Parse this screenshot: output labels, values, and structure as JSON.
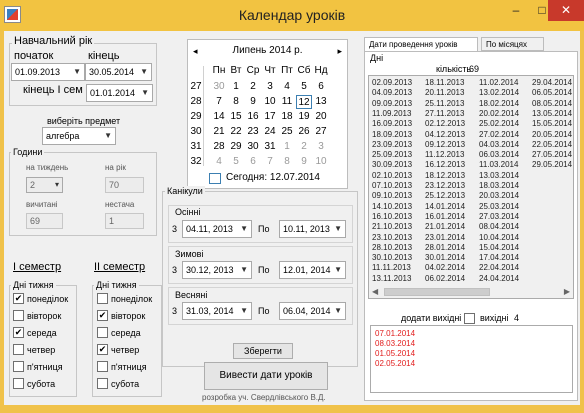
{
  "window": {
    "title": "Календар уроків",
    "min": "–",
    "max": "□",
    "close": "✕"
  },
  "year": {
    "caption": "Навчальний рік",
    "start_label": "початок",
    "start_value": "01.09.2013",
    "end_label": "кінець",
    "end_value": "30.05.2014",
    "sem_end_label": "кінець І сем",
    "sem_end_value": "01.01.2014"
  },
  "subject": {
    "label": "виберіть предмет",
    "value": "алгебра"
  },
  "hours": {
    "caption": "Години",
    "per_week_label": "на тиждень",
    "per_week_value": "2",
    "per_year_label": "на рік",
    "per_year_value": "70",
    "taught_label": "вичитані",
    "taught_value": "69",
    "shortage_label": "нестача",
    "shortage_value": "1"
  },
  "sem1": {
    "title": "І семестр",
    "days_label": "Дні тижня",
    "days": [
      {
        "label": "понеділок",
        "checked": "✔"
      },
      {
        "label": "вівторок",
        "checked": ""
      },
      {
        "label": "середа",
        "checked": "✔"
      },
      {
        "label": "четвер",
        "checked": ""
      },
      {
        "label": "п'ятниця",
        "checked": ""
      },
      {
        "label": "субота",
        "checked": ""
      }
    ]
  },
  "sem2": {
    "title": "ІІ семестр",
    "days_label": "Дні тижня",
    "days": [
      {
        "label": "понеділок",
        "checked": ""
      },
      {
        "label": "вівторок",
        "checked": "✔"
      },
      {
        "label": "середа",
        "checked": ""
      },
      {
        "label": "четвер",
        "checked": "✔"
      },
      {
        "label": "п'ятниця",
        "checked": ""
      },
      {
        "label": "субота",
        "checked": ""
      }
    ]
  },
  "calendar": {
    "prev": "◂",
    "next": "▸",
    "month": "Липень 2014 р.",
    "dow": [
      "Пн",
      "Вт",
      "Ср",
      "Чт",
      "Пт",
      "Сб",
      "Нд"
    ],
    "weeks": [
      {
        "wk": "27",
        "days": [
          "30",
          "1",
          "2",
          "3",
          "4",
          "5",
          "6"
        ]
      },
      {
        "wk": "28",
        "days": [
          "7",
          "8",
          "9",
          "10",
          "11",
          "12",
          "13"
        ]
      },
      {
        "wk": "29",
        "days": [
          "14",
          "15",
          "16",
          "17",
          "18",
          "19",
          "20"
        ]
      },
      {
        "wk": "30",
        "days": [
          "21",
          "22",
          "23",
          "24",
          "25",
          "26",
          "27"
        ]
      },
      {
        "wk": "31",
        "days": [
          "28",
          "29",
          "30",
          "31",
          "1",
          "2",
          "3"
        ]
      },
      {
        "wk": "32",
        "days": [
          "4",
          "5",
          "6",
          "7",
          "8",
          "9",
          "10"
        ]
      }
    ],
    "today_label": "Сегодня: 12.07.2014"
  },
  "vacations": {
    "caption": "Канікули",
    "autumn": {
      "title": "Осінні",
      "num": "3",
      "from": "04.11, 2013",
      "to_label": "По",
      "to": "10.11, 2013"
    },
    "winter": {
      "title": "Зимові",
      "num": "3",
      "from": "30.12, 2013",
      "to_label": "По",
      "to": "12.01, 2014"
    },
    "spring": {
      "title": "Весняні",
      "num": "3",
      "from": "31.03, 2014",
      "to_label": "По",
      "to": "06.04, 2014"
    }
  },
  "buttons": {
    "save": "Зберегти",
    "output": "Вивести дати уроків"
  },
  "credit": "розробка уч. Свердлівського В.Д.",
  "tabs": {
    "dates": "Дати проведення уроків",
    "months": "По місяцях"
  },
  "days_group": {
    "caption": "Дні",
    "count_label": "кількість",
    "count": "69"
  },
  "dates": [
    [
      "02.09.2013",
      "18.11.2013",
      "11.02.2014",
      "29.04.2014"
    ],
    [
      "04.09.2013",
      "20.11.2013",
      "13.02.2014",
      "06.05.2014"
    ],
    [
      "09.09.2013",
      "25.11.2013",
      "18.02.2014",
      "08.05.2014"
    ],
    [
      "11.09.2013",
      "27.11.2013",
      "20.02.2014",
      "13.05.2014"
    ],
    [
      "16.09.2013",
      "02.12.2013",
      "25.02.2014",
      "15.05.2014"
    ],
    [
      "18.09.2013",
      "04.12.2013",
      "27.02.2014",
      "20.05.2014"
    ],
    [
      "23.09.2013",
      "09.12.2013",
      "04.03.2014",
      "22.05.2014"
    ],
    [
      "25.09.2013",
      "11.12.2013",
      "06.03.2014",
      "27.05.2014"
    ],
    [
      "30.09.2013",
      "16.12.2013",
      "11.03.2014",
      "29.05.2014"
    ],
    [
      "02.10.2013",
      "18.12.2013",
      "13.03.2014",
      ""
    ],
    [
      "07.10.2013",
      "23.12.2013",
      "18.03.2014",
      ""
    ],
    [
      "09.10.2013",
      "25.12.2013",
      "20.03.2014",
      ""
    ],
    [
      "14.10.2013",
      "14.01.2014",
      "25.03.2014",
      ""
    ],
    [
      "16.10.2013",
      "16.01.2014",
      "27.03.2014",
      ""
    ],
    [
      "21.10.2013",
      "21.01.2014",
      "08.04.2014",
      ""
    ],
    [
      "23.10.2013",
      "23.01.2014",
      "10.04.2014",
      ""
    ],
    [
      "28.10.2013",
      "28.01.2014",
      "15.04.2014",
      ""
    ],
    [
      "30.10.2013",
      "30.01.2014",
      "17.04.2014",
      ""
    ],
    [
      "11.11.2013",
      "04.02.2014",
      "22.04.2014",
      ""
    ],
    [
      "13.11.2013",
      "06.02.2014",
      "24.04.2014",
      ""
    ]
  ],
  "holidays": {
    "add_label": "додати вихідні",
    "days_label": "вихідні",
    "count": "4",
    "items": [
      "07.01.2014",
      "08.03.2014",
      "01.05.2014",
      "02.05.2014"
    ]
  },
  "colors": {
    "titlebar": "#f2c341",
    "accent": "#3c7fb1",
    "holiday_text": "#e11d1d",
    "close": "#c8392b"
  }
}
